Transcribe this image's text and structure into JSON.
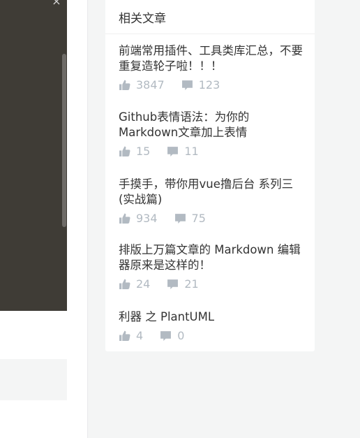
{
  "sidebar_card": {
    "title": "相关文章",
    "articles": [
      {
        "title": "前端常用插件、工具类库汇总，不要重复造轮子啦！！！",
        "likes": "3847",
        "comments": "123"
      },
      {
        "title": "Github表情语法：为你的Markdown文章加上表情",
        "likes": "15",
        "comments": "11"
      },
      {
        "title": "手摸手，带你用vue撸后台 系列三(实战篇)",
        "likes": "934",
        "comments": "75"
      },
      {
        "title": "排版上万篇文章的 Markdown 编辑器原来是这样的！",
        "likes": "24",
        "comments": "21"
      },
      {
        "title": "利器 之 PlantUML",
        "likes": "4",
        "comments": "0"
      }
    ]
  },
  "icons": {
    "like": "thumb-up-icon",
    "comment": "comment-icon",
    "close": "close-icon"
  },
  "colors": {
    "modal_overlay": "#3f3c36",
    "page_bg": "#f4f5f5",
    "meta_text": "#b2bac2",
    "title_text": "#333333"
  }
}
